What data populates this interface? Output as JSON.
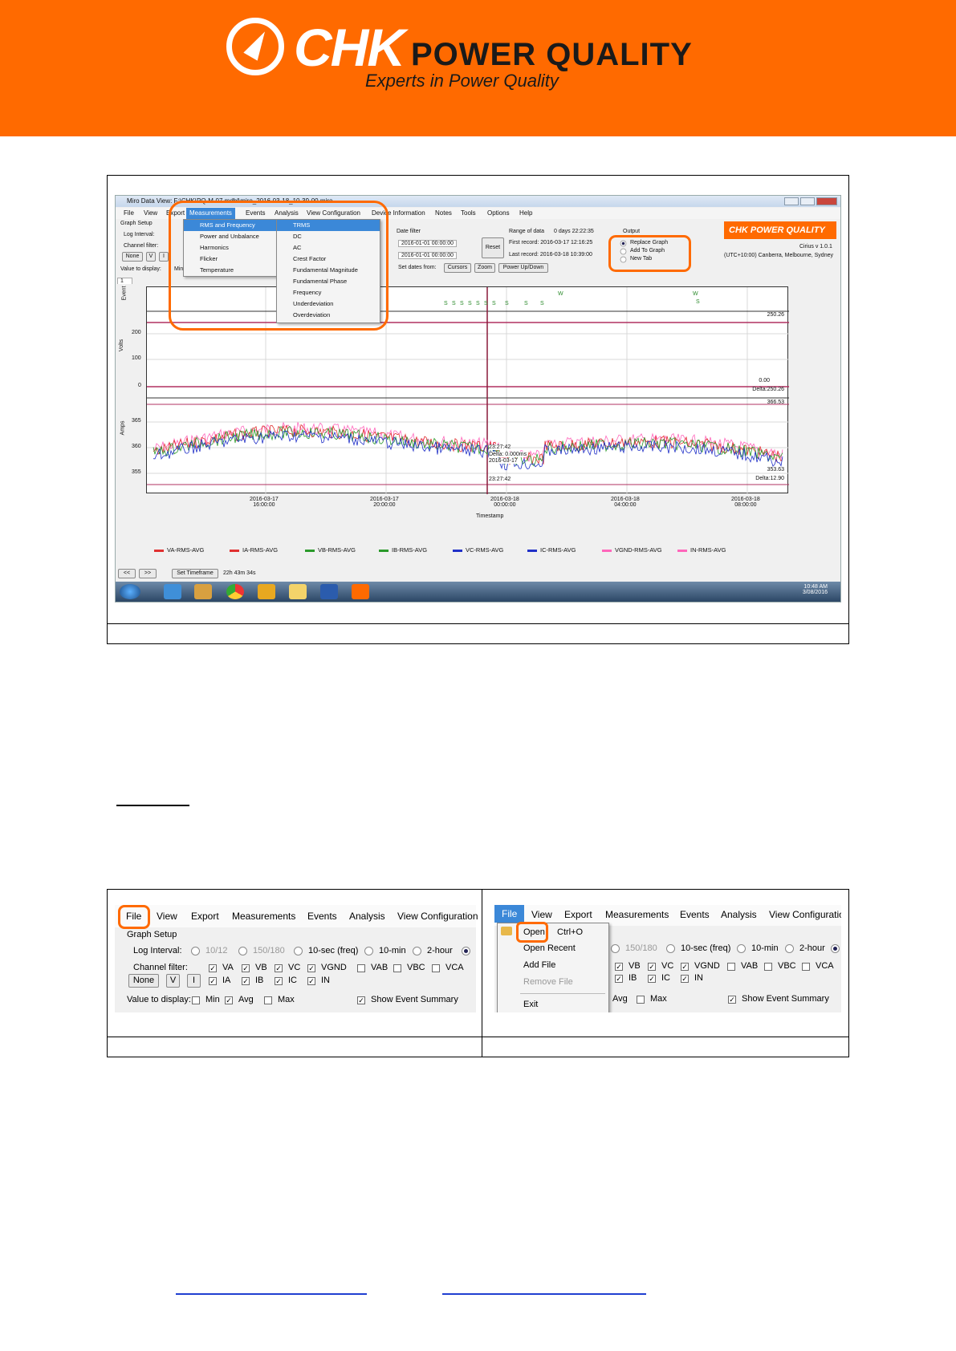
{
  "header": {
    "brand": "CHK",
    "brand_suffix": "POWER QUALITY",
    "tagline": "Experts in Power Quality",
    "brand_color": "#ff6a00"
  },
  "screenshot1": {
    "window_title": "Miro Data View: F:\\CHK\\PQ-M-07.mdbl\\miro_2016-03-18_10-39-00.miro",
    "menu": [
      "File",
      "View",
      "Export",
      "Measurements",
      "Events",
      "Analysis",
      "View Configuration",
      "Device Information",
      "Notes",
      "Tools",
      "Options",
      "Help"
    ],
    "graph_setup": "Graph Setup",
    "log_interval": "Log Interval:",
    "channel_filter": "Channel filter:",
    "none_btn": "None",
    "v_btn": "V",
    "i_btn": "I",
    "value_to_display": "Value to display:",
    "min_label": "Min",
    "measurements_menu": [
      "RMS and Frequency",
      "Power and Unbalance",
      "Harmonics",
      "Flicker",
      "Temperature"
    ],
    "rms_submenu": [
      "TRMS",
      "DC",
      "AC",
      "Crest Factor",
      "Fundamental Magnitude",
      "Fundamental Phase",
      "Frequency",
      "Underdeviation",
      "Overdeviation"
    ],
    "date_filter": "Date filter",
    "date_from": "2016-01-01 00:00:00",
    "date_to": "2016-01-01 00:00:00",
    "reset_btn": "Reset",
    "range_of_data_label": "Range of data",
    "range_of_data_value": "0 days 22:22:35",
    "first_record": "First record: 2016-03-17 12:16:25",
    "last_record": "Last record: 2016-03-18 10:39:00",
    "set_dates_from": "Set dates from:",
    "cursors_btn": "Cursors",
    "zoom_btn": "Zoom",
    "power_btn": "Power Up/Down",
    "output_label": "Output",
    "output_options": [
      "Replace Graph",
      "Add To Graph",
      "New Tab"
    ],
    "version": "Cirius v 1.0.1",
    "timezone": "(UTC+10:00) Canberra, Melbourne, Sydney",
    "tab": "1",
    "event_axis_label": "Event",
    "volts_axis_label": "Volts",
    "amps_axis_label": "Amps",
    "volt_ticks": [
      "200",
      "100",
      "0"
    ],
    "amp_ticks": [
      "365",
      "360",
      "355"
    ],
    "volt_max": "250.26",
    "volt_zero": "0.00",
    "volt_delta": "Delta:250.26",
    "amp_max": "366.53",
    "amp_min": "353.63",
    "amp_delta": "Delta:12.90",
    "cursor_time_a": "23:27:42",
    "cursor_delta": "Delta: 0.000ms",
    "cursor_date": "2016-03-17",
    "cursor_time_b": "23:27:42",
    "time_ticks": [
      {
        "d": "2016-03-17",
        "t": "16:00:00"
      },
      {
        "d": "2016-03-17",
        "t": "20:00:00"
      },
      {
        "d": "2016-03-18",
        "t": "00:00:00"
      },
      {
        "d": "2016-03-18",
        "t": "04:00:00"
      },
      {
        "d": "2016-03-18",
        "t": "08:00:00"
      }
    ],
    "timestamp_label": "Timestamp",
    "legend": [
      {
        "name": "VA-RMS-AVG",
        "color": "#e03030"
      },
      {
        "name": "IA-RMS-AVG",
        "color": "#e03030"
      },
      {
        "name": "VB-RMS-AVG",
        "color": "#2a9a2a"
      },
      {
        "name": "IB-RMS-AVG",
        "color": "#2a9a2a"
      },
      {
        "name": "VC-RMS-AVG",
        "color": "#2030c8"
      },
      {
        "name": "IC-RMS-AVG",
        "color": "#2030c8"
      },
      {
        "name": "VGND-RMS-AVG",
        "color": "#ff66bb"
      },
      {
        "name": "IN-RMS-AVG",
        "color": "#ff66bb"
      }
    ],
    "nav_prev": "<<",
    "nav_next": ">>",
    "set_timeframe": "Set Timeframe",
    "timeframe_value": "22h 43m 34s",
    "clock_time": "10:48 AM",
    "clock_date": "3/08/2016",
    "logo_text": "CHK POWER QUALITY"
  },
  "screenshot2": {
    "menu": [
      "File",
      "View",
      "Export",
      "Measurements",
      "Events",
      "Analysis",
      "View Configuration"
    ],
    "graph_setup": "Graph Setup",
    "log_interval": "Log Interval:",
    "intervals": [
      "10/12",
      "150/180",
      "10-sec (freq)",
      "10-min",
      "2-hour"
    ],
    "channel_filter": "Channel filter:",
    "none_btn": "None",
    "v_btn": "V",
    "i_btn": "I",
    "channels_row1": [
      "VA",
      "VB",
      "VC",
      "VGND",
      "VAB",
      "VBC",
      "VCA"
    ],
    "channels_row2": [
      "IA",
      "IB",
      "IC",
      "IN"
    ],
    "value_to_display": "Value to display:",
    "values": [
      "Min",
      "Avg",
      "Max"
    ],
    "show_event_summary": "Show Event Summary"
  },
  "screenshot3": {
    "menu": [
      "File",
      "View",
      "Export",
      "Measurements",
      "Events",
      "Analysis",
      "View Configuratio"
    ],
    "file_menu": [
      "Open",
      "Open Recent",
      "Add File",
      "Remove File",
      "Exit"
    ],
    "shortcut": "Ctrl+O",
    "intervals": [
      "150/180",
      "10-sec (freq)",
      "10-min",
      "2-hour"
    ],
    "channels_row1": [
      "VB",
      "VC",
      "VGND",
      "VAB",
      "VBC",
      "VCA"
    ],
    "channels_row2": [
      "IB",
      "IC",
      "IN"
    ],
    "values": [
      "Avg",
      "Max"
    ],
    "show_event_summary": "Show Event Summary"
  }
}
